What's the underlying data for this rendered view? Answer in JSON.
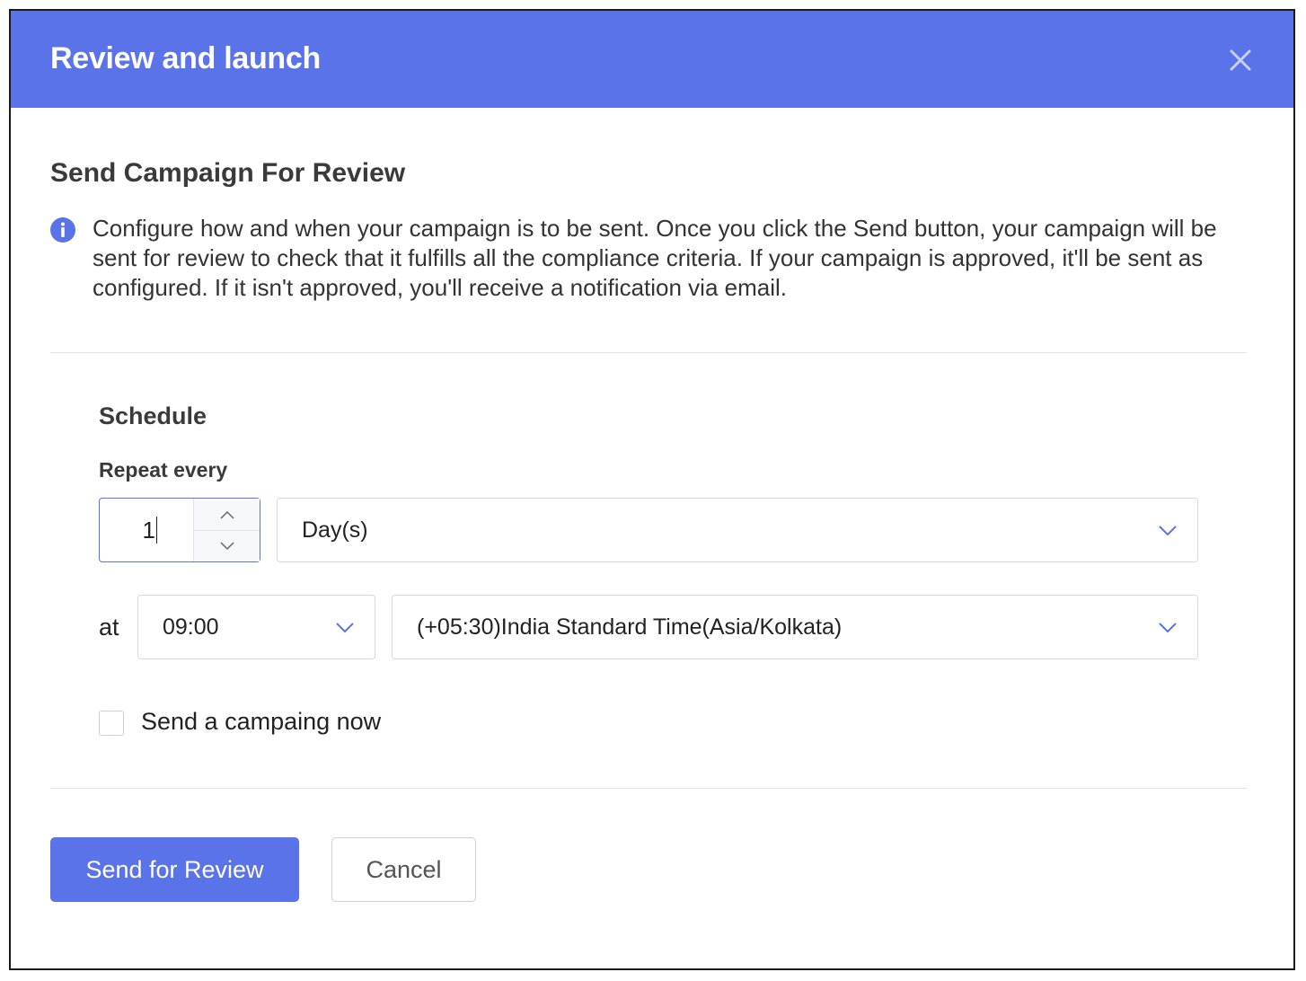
{
  "dialog": {
    "title": "Review and launch",
    "close_icon": "close-icon"
  },
  "section": {
    "title": "Send Campaign For Review",
    "info_icon": "info-icon",
    "info_text": "Configure how and when your campaign is to be sent. Once you click the Send button, your campaign will be sent for review to check that it fulfills all the compliance criteria. If your campaign is approved, it'll be sent as configured. If it isn't approved, you'll receive a notification via email."
  },
  "schedule": {
    "title": "Schedule",
    "repeat_label": "Repeat every",
    "repeat_value": "1",
    "repeat_unit": "Day(s)",
    "at_label": "at",
    "time": "09:00",
    "timezone": "(+05:30)India Standard Time(Asia/Kolkata)",
    "send_now_label": "Send a campaing now",
    "send_now_checked": false
  },
  "actions": {
    "primary_label": "Send for Review",
    "cancel_label": "Cancel"
  },
  "colors": {
    "accent": "#5b73e8",
    "header_text": "#ffffff",
    "border": "#d8d8d8"
  }
}
